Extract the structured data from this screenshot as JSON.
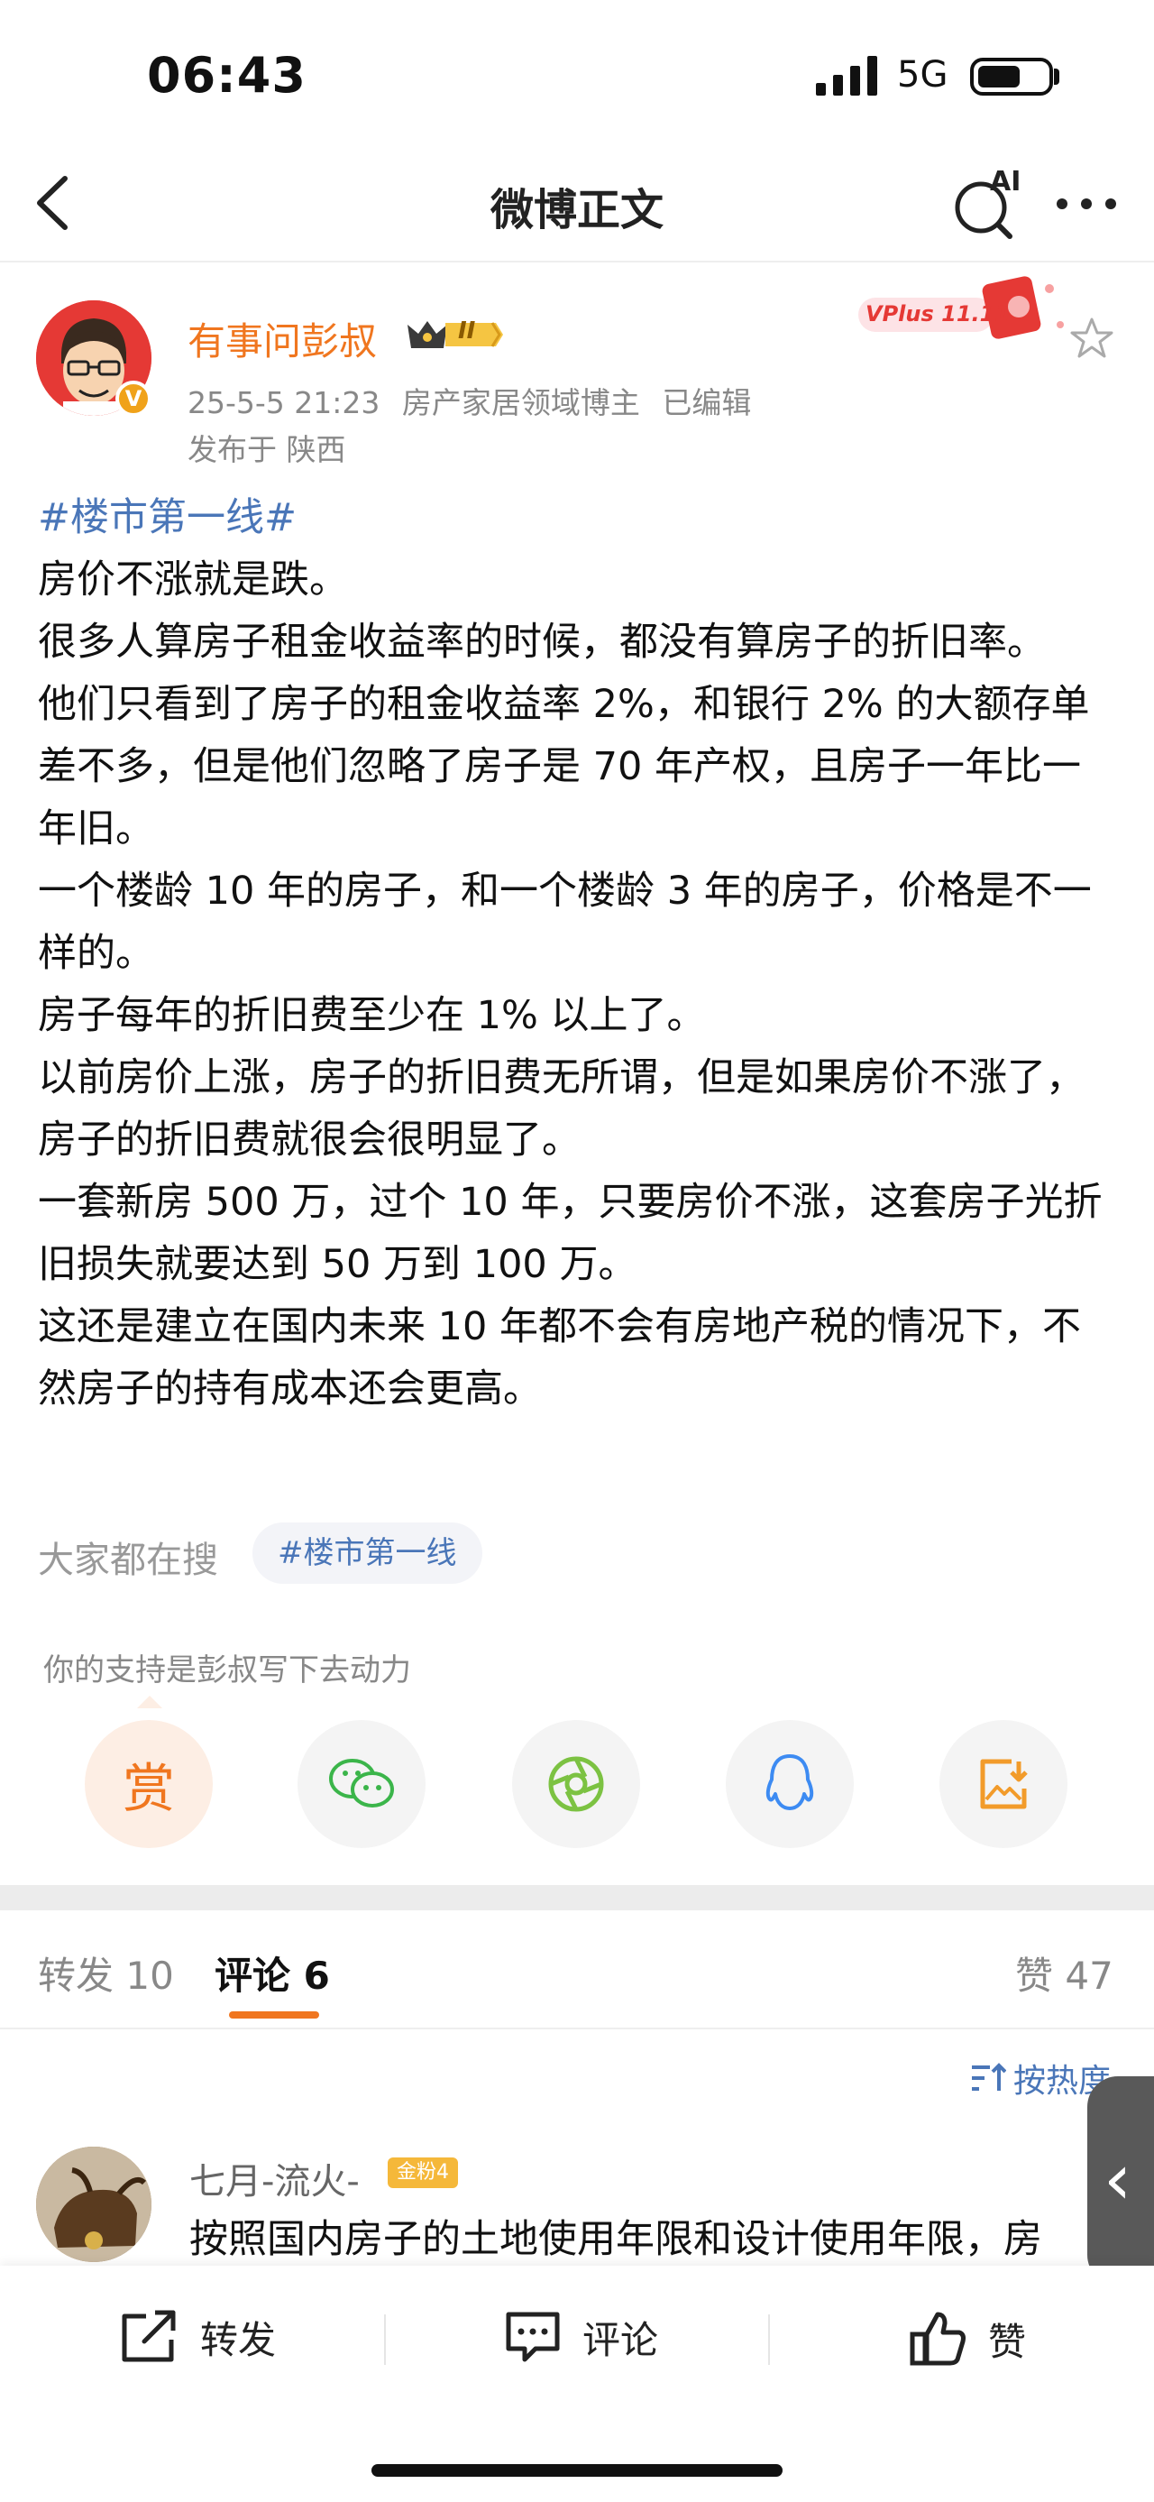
{
  "status_bar": {
    "time": "06:43",
    "network": "5G",
    "battery_level": 0.6
  },
  "nav": {
    "title": "微博正文",
    "ai_label": "AI"
  },
  "author": {
    "name": "有事问彭叔",
    "level_badge": "II",
    "verified_mark": "V",
    "vplus_label": "VPlus 11.11",
    "date": "25-5-5 21:23",
    "role": "房产家居领域博主",
    "edited": "已编辑",
    "location": "发布于 陕西"
  },
  "post": {
    "hashtag": "#楼市第一线#",
    "paragraphs": [
      "房价不涨就是跌。",
      "很多人算房子租金收益率的时候，都没有算房子的折旧率。",
      "他们只看到了房子的租金收益率 2%，和银行 2% 的大额存单差不多，但是他们忽略了房子是 70 年产权，且房子一年比一年旧。",
      "一个楼龄 10 年的房子，和一个楼龄 3 年的房子，价格是不一样的。",
      "房子每年的折旧费至少在 1% 以上了。",
      "以前房价上涨，房子的折旧费无所谓，但是如果房价不涨了，房子的折旧费就很会很明显了。",
      "一套新房 500 万，过个 10 年，只要房价不涨，这套房子光折旧损失就要达到 50 万到 100 万。",
      "这还是建立在国内未来 10 年都不会有房地产税的情况下，不然房子的持有成本还会更高。"
    ]
  },
  "search": {
    "label": "大家都在搜",
    "chip": "#楼市第一线"
  },
  "support": {
    "text": "你的支持是彭叔写下去动力",
    "reward_label": "赏"
  },
  "tabs": {
    "repost": "转发 10",
    "comment": "评论 6",
    "like": "赞 47"
  },
  "sort": {
    "label": "按热度"
  },
  "comment": {
    "name": "七月-流火-",
    "fan_badge": "金粉4",
    "text": "按照国内房子的土地使用年限和设计使用年限，房"
  },
  "bottom_bar": {
    "repost": "转发",
    "comment": "评论",
    "like": "赞"
  },
  "colors": {
    "accent": "#f0761f",
    "link": "#4a76b8",
    "muted": "#888888"
  }
}
